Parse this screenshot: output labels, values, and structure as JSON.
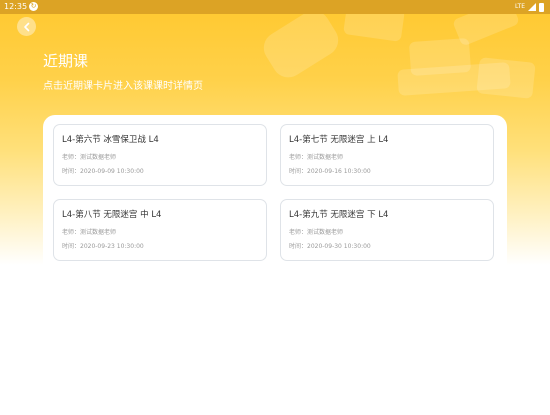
{
  "status_bar": {
    "time": "12:35",
    "network": "LTE"
  },
  "header": {
    "title": "近期课",
    "subtitle": "点击近期课卡片进入该课课时详情页"
  },
  "courses": [
    {
      "title": "L4-第六节 冰雪保卫战 L4",
      "teacher": "老师：测试数据老师",
      "time": "时间：2020-09-09 10:30:00"
    },
    {
      "title": "L4-第七节 无限迷宫 上 L4",
      "teacher": "老师：测试数据老师",
      "time": "时间：2020-09-16 10:30:00"
    },
    {
      "title": "L4-第八节 无限迷宫 中 L4",
      "teacher": "老师：测试数据老师",
      "time": "时间：2020-09-23 10:30:00"
    },
    {
      "title": "L4-第九节 无限迷宫 下 L4",
      "teacher": "老师：测试数据老师",
      "time": "时间：2020-09-30 10:30:00"
    }
  ],
  "colors": {
    "accent": "#ffc82e",
    "status_bar": "#dca325",
    "card_border": "#dfe3e8"
  },
  "icons": {
    "back": "chevron-left-icon",
    "sync": "sync-icon",
    "signal": "signal-icon",
    "battery": "battery-icon"
  }
}
